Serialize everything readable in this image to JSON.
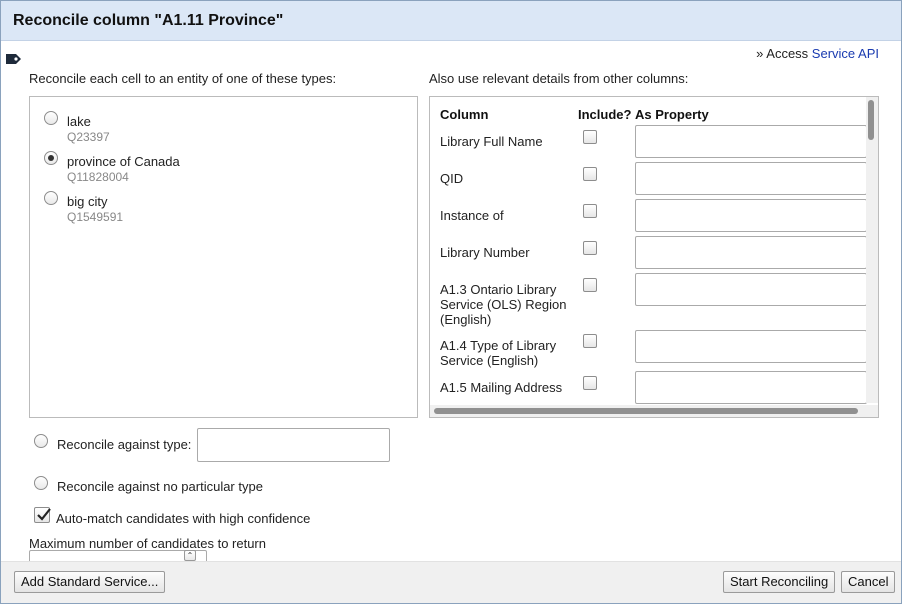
{
  "dialog": {
    "title": "Reconcile column \"A1.11 Province\"",
    "access_prefix": "» Access ",
    "access_link": "Service API"
  },
  "types_section": {
    "label": "Reconcile each cell to an entity of one of these types:",
    "types": [
      {
        "name": "lake",
        "id": "Q23397",
        "selected": false
      },
      {
        "name": "province of Canada",
        "id": "Q11828004",
        "selected": true
      },
      {
        "name": "big city",
        "id": "Q1549591",
        "selected": false
      }
    ]
  },
  "columns_section": {
    "label": "Also use relevant details from other columns:",
    "headers": {
      "column": "Column",
      "include": "Include?",
      "property": "As Property"
    },
    "rows": [
      {
        "name": "Library Full Name",
        "include": false,
        "property": ""
      },
      {
        "name": "QID",
        "include": false,
        "property": ""
      },
      {
        "name": "Instance of",
        "include": false,
        "property": ""
      },
      {
        "name": "Library Number",
        "include": false,
        "property": ""
      },
      {
        "name": "A1.3 Ontario Library Service (OLS) Region (English)",
        "include": false,
        "property": ""
      },
      {
        "name": "A1.4 Type of Library Service (English)",
        "include": false,
        "property": ""
      },
      {
        "name": "A1.5 Mailing Address",
        "include": false,
        "property": ""
      }
    ]
  },
  "options": {
    "against_type_label": "Reconcile against type:",
    "against_type_value": "",
    "no_type_label": "Reconcile against no particular type",
    "automatch_label": "Auto-match candidates with high confidence",
    "automatch_checked": true,
    "max_candidates_label": "Maximum number of candidates to return",
    "max_candidates_value": ""
  },
  "footer": {
    "add_service_label": "Add Standard Service...",
    "start_label": "Start Reconciling",
    "cancel_label": "Cancel"
  },
  "icons": {
    "side": "tag-icon",
    "spinner_up": "chevron-up-icon",
    "spinner_down": "chevron-down-icon"
  }
}
